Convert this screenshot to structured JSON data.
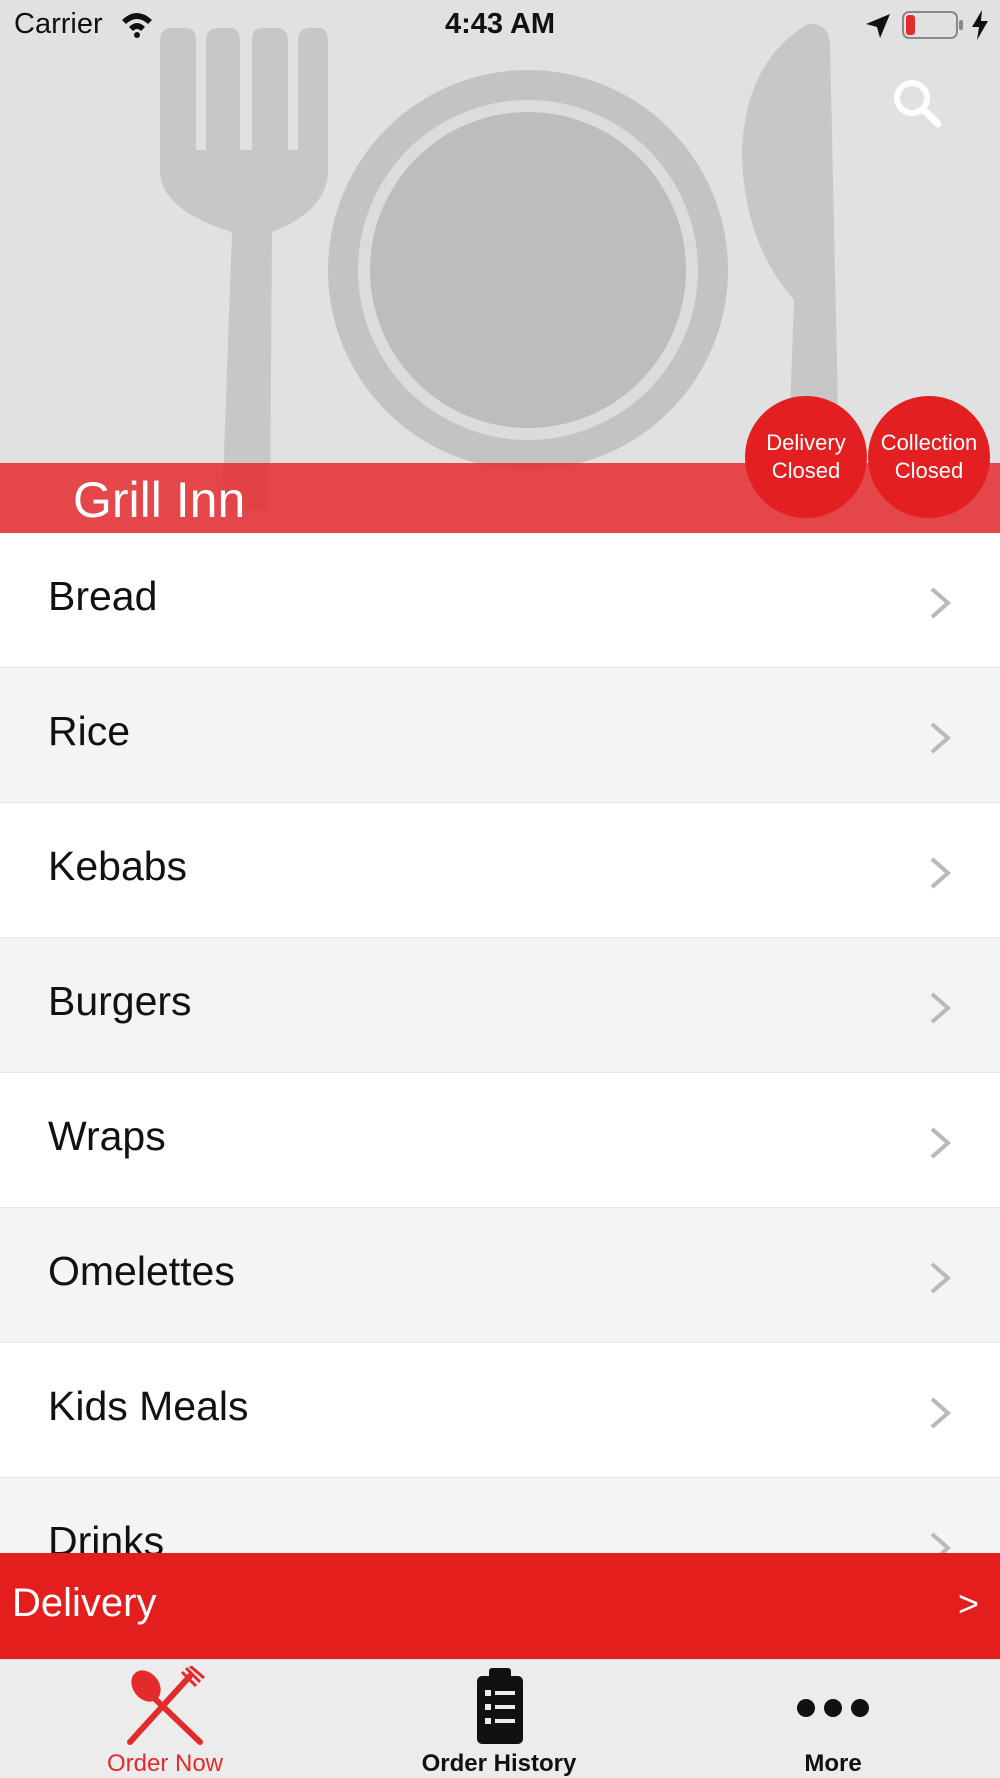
{
  "status_bar": {
    "carrier": "Carrier",
    "time": "4:43 AM"
  },
  "header": {
    "restaurant_name": "Grill Inn",
    "delivery_status": {
      "line1": "Delivery",
      "line2": "Closed"
    },
    "collection_status": {
      "line1": "Collection",
      "line2": "Closed"
    }
  },
  "menu": {
    "items": [
      {
        "label": "Bread"
      },
      {
        "label": "Rice"
      },
      {
        "label": "Kebabs"
      },
      {
        "label": "Burgers"
      },
      {
        "label": "Wraps"
      },
      {
        "label": "Omelettes"
      },
      {
        "label": "Kids Meals"
      },
      {
        "label": "Drinks"
      }
    ]
  },
  "delivery_bar": {
    "label": "Delivery",
    "arrow": ">"
  },
  "tab_bar": {
    "tabs": [
      {
        "label": "Order Now",
        "icon": "fork-spoon-icon",
        "active": true
      },
      {
        "label": "Order History",
        "icon": "clipboard-icon",
        "active": false
      },
      {
        "label": "More",
        "icon": "more-dots-icon",
        "active": false
      }
    ]
  },
  "colors": {
    "accent_red": "#e41d1d",
    "name_bar": "#e45052",
    "hero_background": "#e1e1e1",
    "active_tab": "#e42b2b"
  }
}
